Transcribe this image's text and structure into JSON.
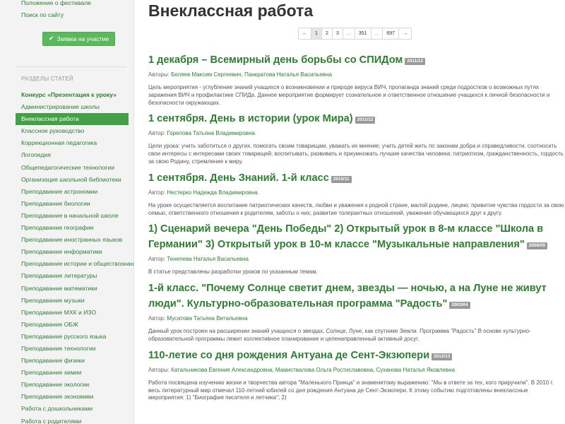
{
  "sidebar": {
    "top_links": [
      "Положение о фестивале",
      "Поиск по сайту"
    ],
    "apply_button": {
      "icon": "checkmark-icon",
      "label": "Заявка на участие"
    },
    "section_title": "РАЗДЕЛЫ СТАТЕЙ",
    "sections": [
      {
        "label": "Конкурс «Презентация к уроку»",
        "type": "parent"
      },
      {
        "label": "Администрирование школы",
        "type": ""
      },
      {
        "label": "Внеклассная работа",
        "type": "active"
      },
      {
        "label": "Классное руководство",
        "type": ""
      },
      {
        "label": "Коррекционная педагогика",
        "type": ""
      },
      {
        "label": "Логопедия",
        "type": ""
      },
      {
        "label": "Общепедагогические технологии",
        "type": ""
      },
      {
        "label": "Организация школьной библиотеки",
        "type": ""
      },
      {
        "label": "Преподавание астрономии",
        "type": ""
      },
      {
        "label": "Преподавание биологии",
        "type": ""
      },
      {
        "label": "Преподавание в начальной школе",
        "type": ""
      },
      {
        "label": "Преподавание географии",
        "type": ""
      },
      {
        "label": "Преподавание иностранных языков",
        "type": ""
      },
      {
        "label": "Преподавание информатики",
        "type": ""
      },
      {
        "label": "Преподавание истории и обществознания",
        "type": ""
      },
      {
        "label": "Преподавание литературы",
        "type": ""
      },
      {
        "label": "Преподавание математики",
        "type": ""
      },
      {
        "label": "Преподавание музыки",
        "type": ""
      },
      {
        "label": "Преподавание МХК и ИЗО",
        "type": ""
      },
      {
        "label": "Преподавание ОБЖ",
        "type": ""
      },
      {
        "label": "Преподавание русского языка",
        "type": ""
      },
      {
        "label": "Преподавание технологии",
        "type": ""
      },
      {
        "label": "Преподавание физики",
        "type": ""
      },
      {
        "label": "Преподавание химии",
        "type": ""
      },
      {
        "label": "Преподавание экологии",
        "type": ""
      },
      {
        "label": "Преподавание экономики",
        "type": ""
      },
      {
        "label": "Работа с дошкольниками",
        "type": ""
      },
      {
        "label": "Работа с родителями",
        "type": ""
      }
    ]
  },
  "main": {
    "title": "Внеклассная работа",
    "pagination": [
      "←",
      "1",
      "2",
      "3",
      "...",
      "351",
      "...",
      "697",
      "→"
    ],
    "current_page": "1",
    "articles": [
      {
        "title": "1 декабря – Всемирный день борьбы со СПИДом",
        "date": "2011/12",
        "authors_label": "Авторы:",
        "authors": "Беляев Максим Сергеевич, Панкратова Наталья Васильевна",
        "summary": "Цель мероприятия - углубление знаний учащихся о возникновении и природе вируса ВИЧ, пропаганда знаний среди подростков о возможных путях заражения ВИЧ и профилактике СПИДа. Данное мероприятие формирует сознательное и ответственное отношение учащихся к личной безопасности и безопасности окружающих."
      },
      {
        "title": "1 сентября. День в истории (урок Мира)",
        "date": "2011/12",
        "authors_label": "Автор:",
        "authors": "Горелова Татьяна Владимировна",
        "summary": "Цели урока: учить заботиться о других, помогать своим товарищам, уважать их мнение; учить детей жить по законам добра и справедливости, соотносить свои интересы с интересами своих товарищей; воспитывать, развивать и приумножать лучшие качества человека: патриотизм, гражданственность, гордость за свою Родину, стремление к миру."
      },
      {
        "title": "1 сентября. День Знаний. 1-й класс",
        "date": "2010/11",
        "authors_label": "Автор:",
        "authors": "Нестерко Надежда Владимировна",
        "summary": "На уроке осуществляется воспитание патриотических качеств, любви и уважения к родной стране, малой родине, лицею; привитие чувства гордости за свою семью, ответственного отношения к родителям, заботы о них; развитие толерантных отношений, уважения обучающихся друг к другу."
      },
      {
        "title": "1) Сценарий вечера \"День Победы\" 2) Открытый урок в 8-м классе \"Школа в Германии\" 3) Открытый урок в 10-м классе \"Музыкальные направления\"",
        "date": "2008/09",
        "authors_label": "Автор:",
        "authors": "Тенenева Наталья Васильевна",
        "summary": "В статье представлены разработки уроков по указанным темам."
      },
      {
        "title": "1-й класс. \"Почему Солнце светит днем, звезды — ночью, а на Луне не живут люди\". Культурно-образовательная программа \"Радость\"",
        "date": "2003/04",
        "authors_label": "Автор:",
        "authors": "Мусатова Татьяна Витальевна",
        "summary": "Данный урок построен на расширении знаний учащихся о звездах, Солнце, Луне, как спутнике Земли. Программа \"Радость\" В основе культурно-образовательной программы лежит коллективное планирование и целенаправленный активный досуг."
      },
      {
        "title": "110-летие со дня рождения Антуана де Сент-Экзюпери",
        "date": "2012/13",
        "authors_label": "Авторы:",
        "authors": "Катальникова Евгения Александровна, Мамиствалова Ольга Ростиславовна, Суханова Наталья Яковлевна",
        "summary": "Работа посвящена изучению жизни и творчества автора \"Маленького Принца\" и знаменитому выражению: \"Мы в ответе за тех, кого приручили\". В 2010 г. весь литературный мир отмечал 110-летний юбилей со дня рождения Антуана де Сент-Экзюпери. К этому событию подготовлены внеклассные мероприятия: 1) \"Биография писателя и летчика\"; 2)"
      }
    ]
  },
  "colors": {
    "link_green": "#2e7d32",
    "active_bg": "#43a047",
    "button_green": "#5cb85c",
    "date_badge": "#999999"
  }
}
